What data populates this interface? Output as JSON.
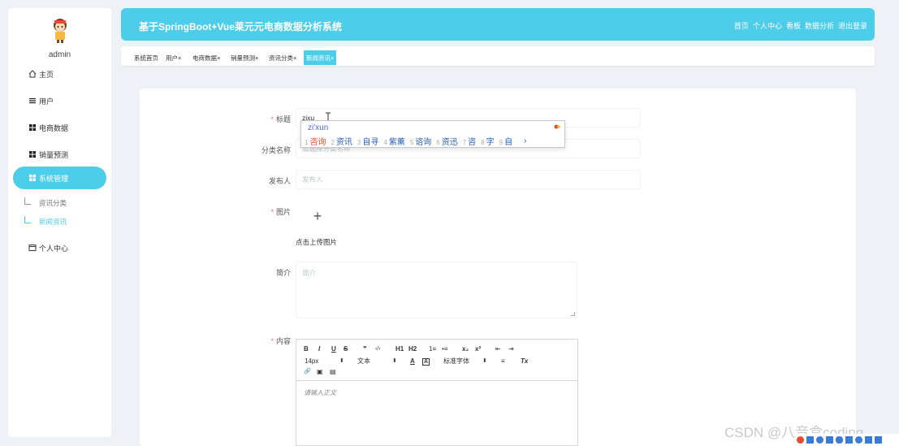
{
  "sidebar": {
    "username": "admin",
    "items": [
      {
        "label": "主页",
        "icon": "home-icon"
      },
      {
        "label": "用户",
        "icon": "list-icon"
      },
      {
        "label": "电商数据",
        "icon": "grid-icon"
      },
      {
        "label": "销量预测",
        "icon": "grid-icon"
      },
      {
        "label": "系统管理",
        "icon": "grid-icon",
        "active": true
      },
      {
        "label": "个人中心",
        "icon": "window-icon"
      }
    ],
    "subitems": [
      {
        "label": "资讯分类"
      },
      {
        "label": "新闻资讯",
        "active": true
      }
    ]
  },
  "header": {
    "title": "基于SpringBoot+Vue莱元元电商数据分析系统",
    "links": [
      "首页",
      "个人中心",
      "看板",
      "数据分析",
      "退出登录"
    ],
    "bg_color": "#4ccdea"
  },
  "tabs": [
    {
      "label": "系统首页",
      "closable": false
    },
    {
      "label": "用户",
      "closable": true
    },
    {
      "label": "电商数据",
      "closable": true
    },
    {
      "label": "销量预测",
      "closable": true
    },
    {
      "label": "资讯分类",
      "closable": true
    },
    {
      "label": "新闻资讯",
      "closable": true,
      "active": true
    }
  ],
  "tab_close_glyph": "×",
  "form": {
    "title": {
      "label": "标题",
      "required": true,
      "value": "zixu"
    },
    "category": {
      "label": "分类名称",
      "placeholder": "请选择分类名称"
    },
    "publisher": {
      "label": "发布人",
      "placeholder": "发布人"
    },
    "image": {
      "label": "图片",
      "required": true,
      "upload_text": "点击上传图片",
      "plus": "+"
    },
    "intro": {
      "label": "简介",
      "placeholder": "简介"
    },
    "content": {
      "label": "内容",
      "required": true,
      "placeholder": "请输入正文"
    }
  },
  "ime": {
    "composition": "zi'xun",
    "candidates": [
      {
        "num": "1",
        "text": "咨询"
      },
      {
        "num": "2",
        "text": "资讯"
      },
      {
        "num": "3",
        "text": "自寻"
      },
      {
        "num": "4",
        "text": "紫薰"
      },
      {
        "num": "5",
        "text": "谘询"
      },
      {
        "num": "6",
        "text": "资迅"
      },
      {
        "num": "7",
        "text": "咨"
      },
      {
        "num": "8",
        "text": "字"
      },
      {
        "num": "9",
        "text": "自"
      }
    ],
    "next": "›"
  },
  "editor": {
    "bold": "B",
    "italic": "I",
    "underline": "U",
    "strike": "S",
    "quote": "❞",
    "code": "‹/›",
    "h1": "H1",
    "h2": "H2",
    "ol": "1≡",
    "ul": "•≡",
    "sub": "x₂",
    "sup": "x²",
    "outdent": "⇤",
    "indent": "⇥",
    "size": "14px",
    "size_arrow": "⬍",
    "format": "文本",
    "format_arrow": "⬍",
    "color": "A",
    "bg": "A",
    "font": "标准字体",
    "font_arrow": "⬍",
    "align": "≡",
    "clean": "Tx",
    "link": "🔗",
    "image": "▣",
    "video": "▤"
  },
  "watermark": "CSDN @八音盒coding"
}
